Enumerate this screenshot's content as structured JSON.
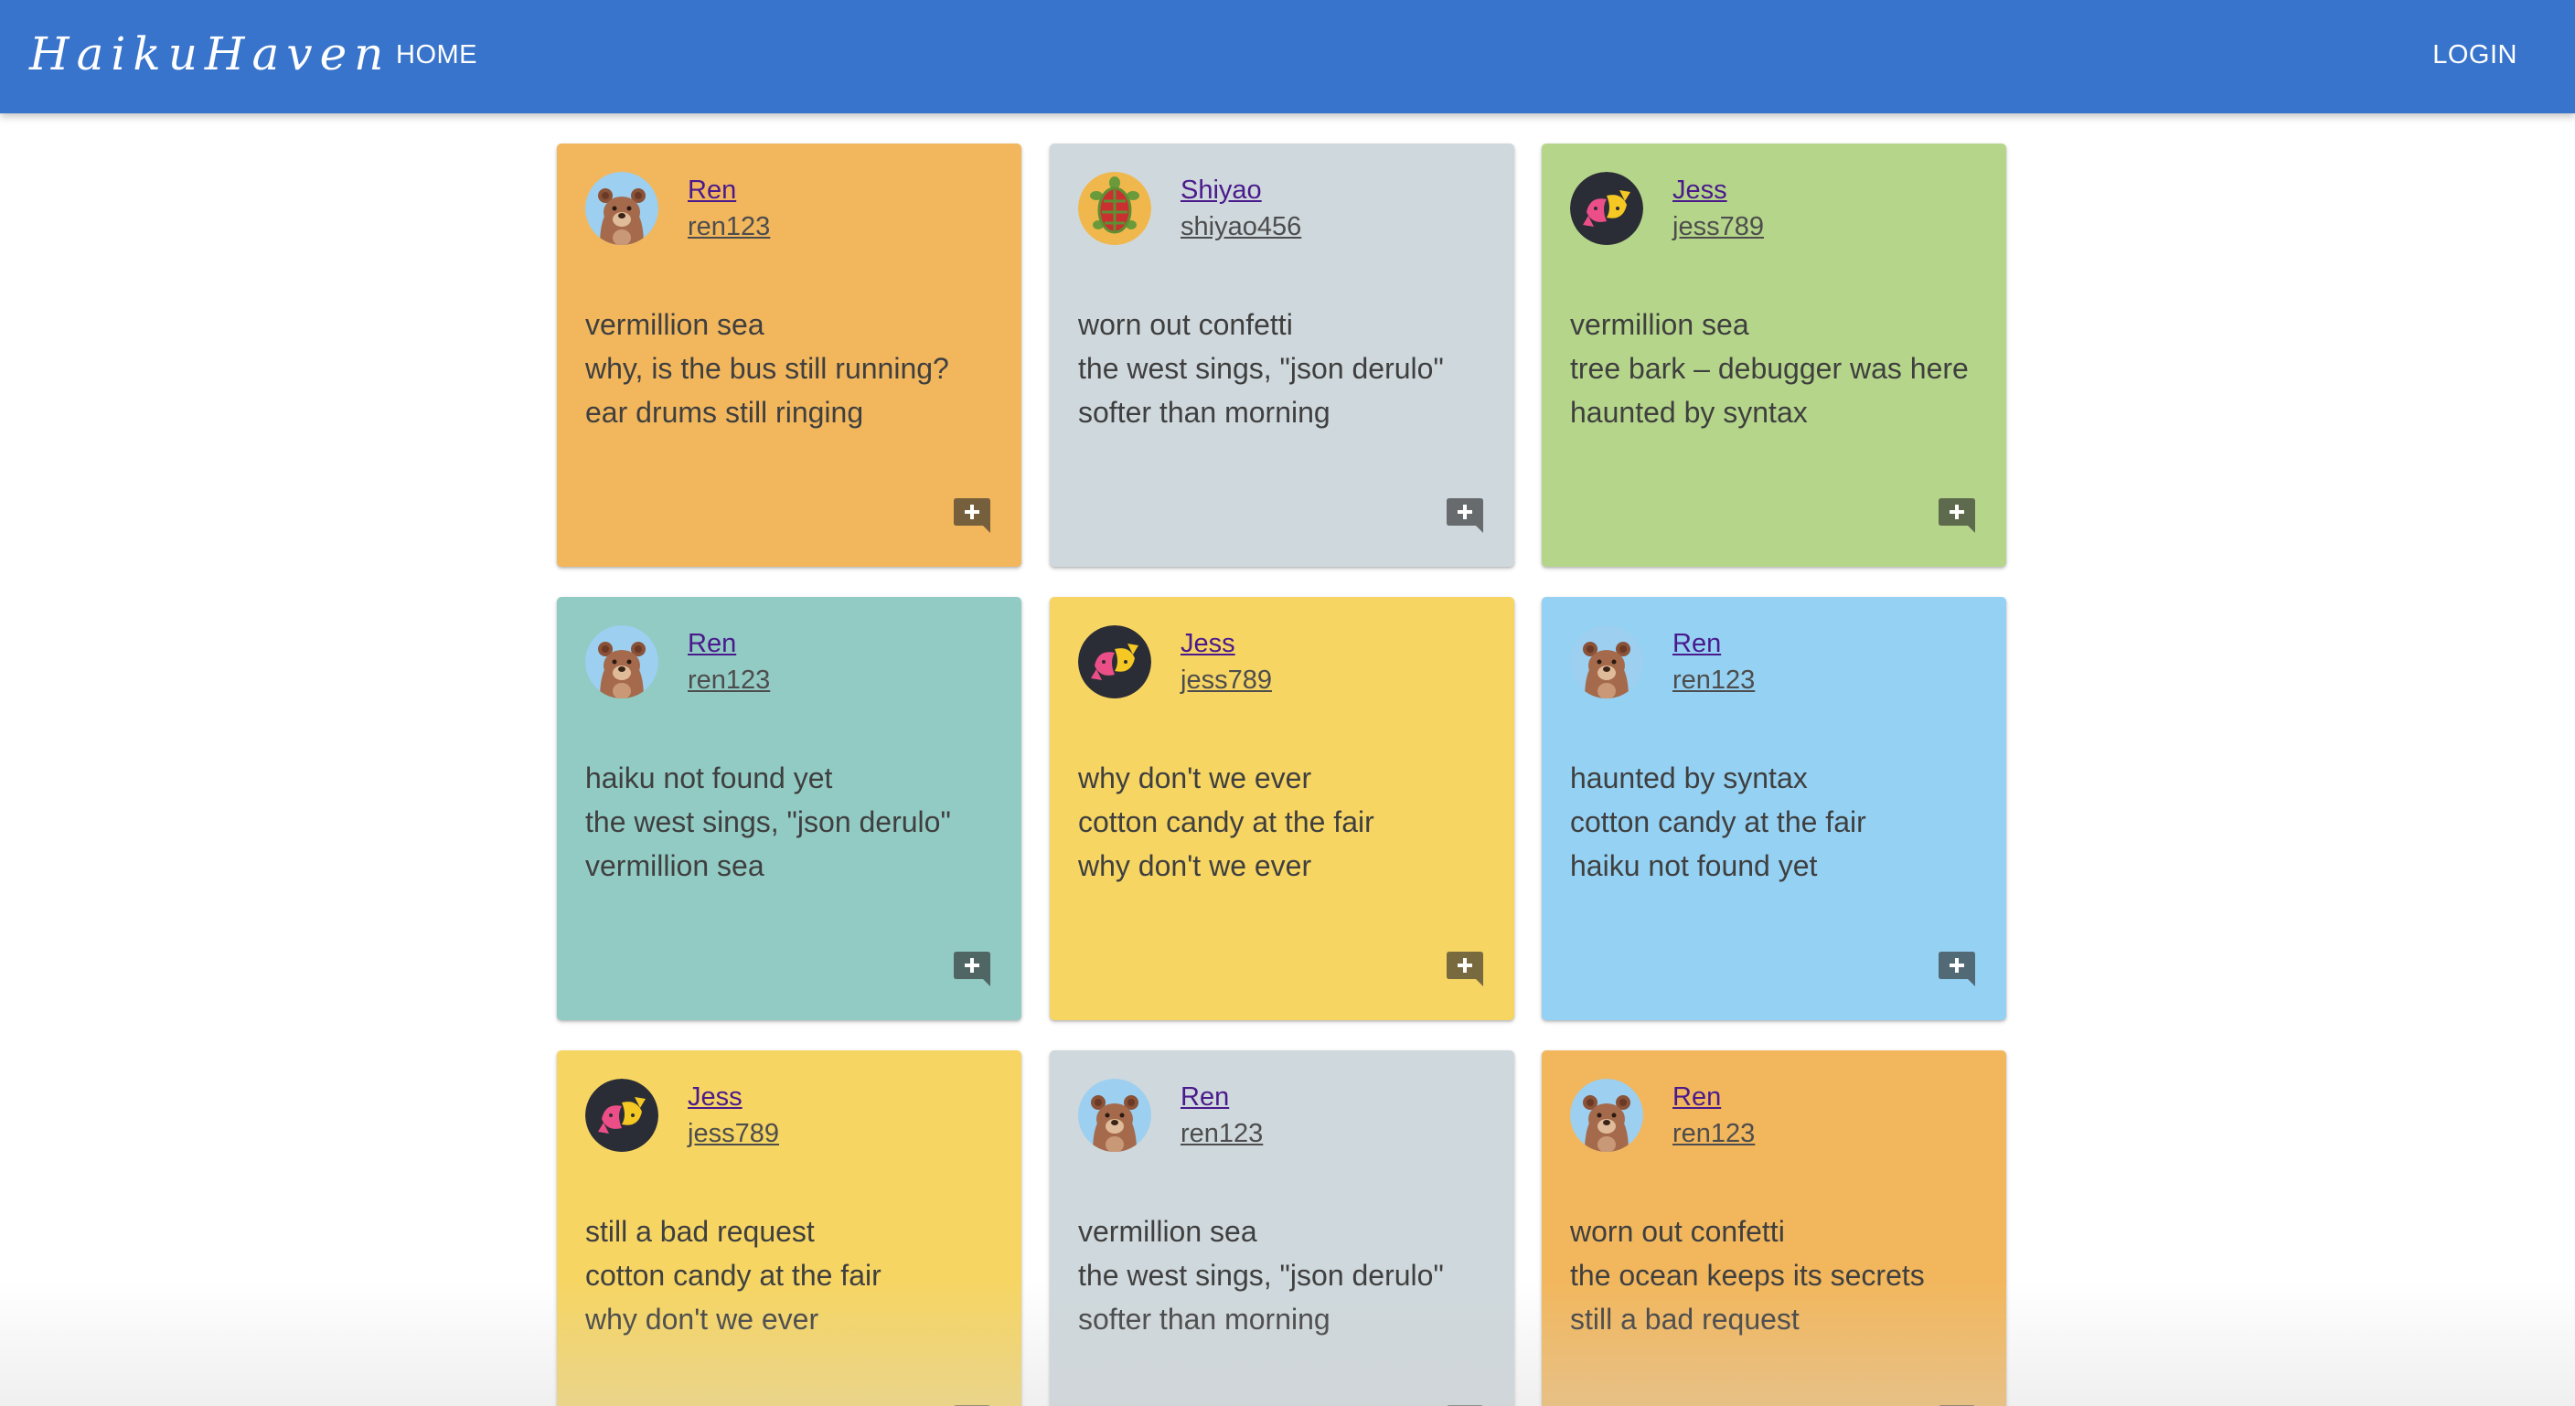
{
  "app": {
    "brand": "HaikuHaven",
    "nav_home": "HOME",
    "nav_login": "LOGIN",
    "colors": {
      "appbar": "#3874cb",
      "orange": "#f2b75d",
      "gray": "#cfd8dc",
      "green": "#b5d68a",
      "teal": "#92cbc4",
      "yellow": "#f6d563",
      "blue": "#95d1f3"
    }
  },
  "cards": [
    {
      "color": "#f2b75d",
      "avatar_icon": "bear-avatar-icon",
      "name": "Ren",
      "handle": "ren123",
      "lines": [
        "vermillion sea",
        "why, is the bus still running?",
        "ear drums still ringing"
      ],
      "comment_icon": "add-comment-icon"
    },
    {
      "color": "#cfd8dc",
      "avatar_icon": "turtle-avatar-icon",
      "name": "Shiyao",
      "handle": "shiyao456",
      "lines": [
        "worn out confetti",
        "the west sings, \"json derulo\"",
        "softer than morning"
      ],
      "comment_icon": "add-comment-icon"
    },
    {
      "color": "#b5d68a",
      "avatar_icon": "koi-fish-avatar-icon",
      "name": "Jess",
      "handle": "jess789",
      "lines": [
        "vermillion sea",
        "tree bark – debugger was here",
        "haunted by syntax"
      ],
      "comment_icon": "add-comment-icon"
    },
    {
      "color": "#92cbc4",
      "avatar_icon": "bear-avatar-icon",
      "name": "Ren",
      "handle": "ren123",
      "lines": [
        "haiku not found yet",
        "the west sings, \"json derulo\"",
        "vermillion sea"
      ],
      "comment_icon": "add-comment-icon"
    },
    {
      "color": "#f6d563",
      "avatar_icon": "koi-fish-avatar-icon",
      "name": "Jess",
      "handle": "jess789",
      "lines": [
        "why don't we ever",
        "cotton candy at the fair",
        "why don't we ever"
      ],
      "comment_icon": "add-comment-icon"
    },
    {
      "color": "#95d1f3",
      "avatar_icon": "bear-avatar-icon",
      "name": "Ren",
      "handle": "ren123",
      "lines": [
        "haunted by syntax",
        "cotton candy at the fair",
        "haiku not found yet"
      ],
      "comment_icon": "add-comment-icon"
    },
    {
      "color": "#f6d563",
      "avatar_icon": "koi-fish-avatar-icon",
      "name": "Jess",
      "handle": "jess789",
      "lines": [
        "still a bad request",
        "cotton candy at the fair",
        "why don't we ever"
      ],
      "comment_icon": "add-comment-icon"
    },
    {
      "color": "#cfd8dc",
      "avatar_icon": "bear-avatar-icon",
      "name": "Ren",
      "handle": "ren123",
      "lines": [
        "vermillion sea",
        "the west sings, \"json derulo\"",
        "softer than morning"
      ],
      "comment_icon": "add-comment-icon"
    },
    {
      "color": "#f2b75d",
      "avatar_icon": "bear-avatar-icon",
      "name": "Ren",
      "handle": "ren123",
      "lines": [
        "worn out confetti",
        "the ocean keeps its secrets",
        "still a bad request"
      ],
      "comment_icon": "add-comment-icon"
    }
  ]
}
